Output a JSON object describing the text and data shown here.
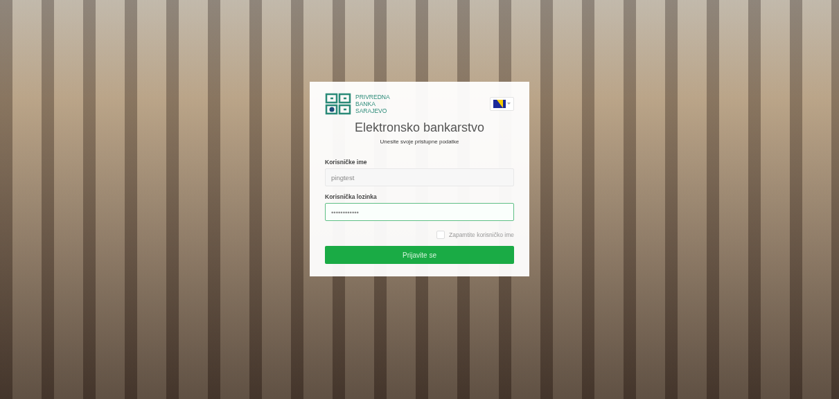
{
  "logo_text": [
    "PRIVREDNA",
    "BANKA",
    "SARAJEVO"
  ],
  "title": "Elektronsko bankarstvo",
  "subtitle": "Unesite svoje pristupne podatke",
  "fields": [
    {
      "label": "Korisničke ime",
      "value": "pingtest",
      "focused": false
    },
    {
      "label": "Korisnička lozinka",
      "value": "••••••••••••",
      "focused": true
    }
  ],
  "remember": {
    "label": "Zapamtite korisničko ime",
    "checked": false
  },
  "submit": "Prijavite se"
}
